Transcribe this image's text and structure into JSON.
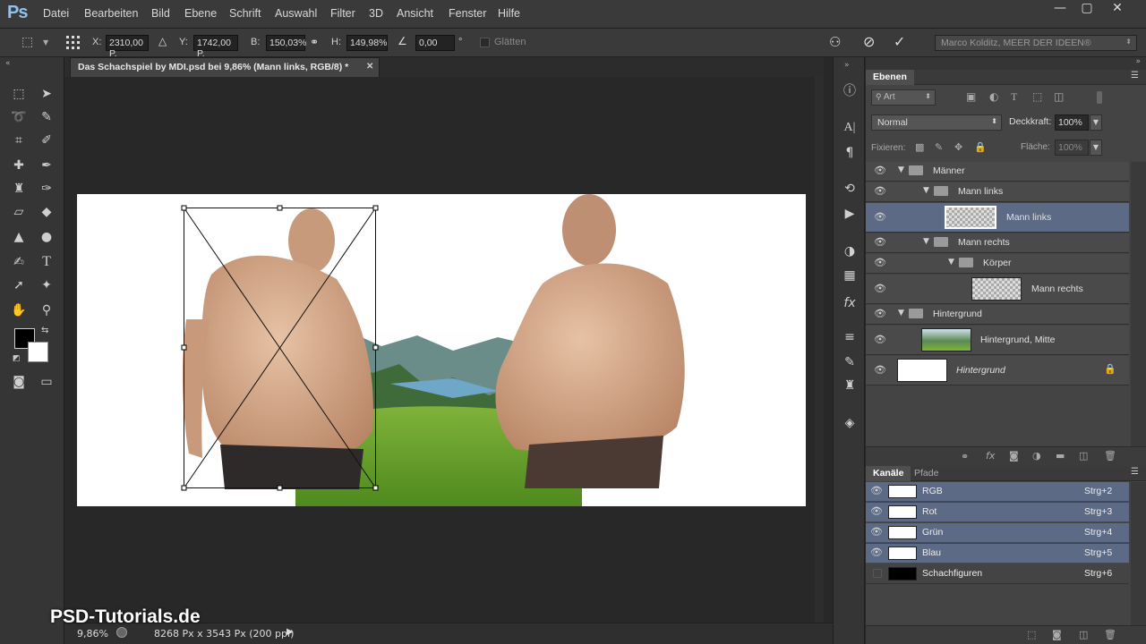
{
  "app": {
    "logo": "Ps"
  },
  "menu": [
    "Datei",
    "Bearbeiten",
    "Bild",
    "Ebene",
    "Schrift",
    "Auswahl",
    "Filter",
    "3D",
    "Ansicht",
    "Fenster",
    "Hilfe"
  ],
  "window_controls": {
    "minimize": "—",
    "maximize": "▢",
    "close": "✕"
  },
  "options": {
    "x_label": "X:",
    "x_value": "2310,00 P.",
    "y_label": "Y:",
    "y_value": "1742,00 P.",
    "w_label": "B:",
    "w_value": "150,03%",
    "h_label": "H:",
    "h_value": "149,98%",
    "angle_value": "0,00",
    "angle_unit": "°",
    "smooth_label": "Glätten",
    "workspace": "Marco Kolditz, MEER DER IDEEN®"
  },
  "document": {
    "tab_title": "Das Schachspiel by MDI.psd bei 9,86% (Mann links, RGB/8) *",
    "close": "✕"
  },
  "status": {
    "zoom": "9,86%",
    "info": "8268 Px x 3543 Px (200 ppi)"
  },
  "watermark": "PSD-Tutorials.de",
  "layers_panel": {
    "tab": "Ebenen",
    "filter": "Art",
    "blend_mode": "Normal",
    "opacity_label": "Deckkraft:",
    "opacity_value": "100%",
    "lock_label": "Fixieren:",
    "fill_label": "Fläche:",
    "fill_value": "100%",
    "layers": [
      {
        "name": "Männer",
        "kind": "group",
        "indent": 0
      },
      {
        "name": "Mann links",
        "kind": "group",
        "indent": 1
      },
      {
        "name": "Mann links",
        "kind": "smart",
        "indent": 2,
        "selected": true
      },
      {
        "name": "Mann rechts",
        "kind": "group",
        "indent": 1
      },
      {
        "name": "Körper",
        "kind": "group",
        "indent": 2
      },
      {
        "name": "Mann rechts",
        "kind": "smart",
        "indent": 3
      },
      {
        "name": "Hintergrund",
        "kind": "group",
        "indent": 0
      },
      {
        "name": "Hintergrund, Mitte",
        "kind": "smart",
        "indent": 1
      },
      {
        "name": "Hintergrund",
        "kind": "background",
        "indent": 0
      }
    ]
  },
  "channels_panel": {
    "tabs": [
      "Kanäle",
      "Pfade"
    ],
    "channels": [
      {
        "name": "RGB",
        "shortcut": "Strg+2"
      },
      {
        "name": "Rot",
        "shortcut": "Strg+3"
      },
      {
        "name": "Grün",
        "shortcut": "Strg+4"
      },
      {
        "name": "Blau",
        "shortcut": "Strg+5"
      },
      {
        "name": "Schachfiguren",
        "shortcut": "Strg+6"
      }
    ]
  },
  "colors": {
    "accent_selection": "#5c6a85",
    "panel_bg": "#444444",
    "canvas_bg": "#282828",
    "ps_blue": "#8fc2ee"
  }
}
